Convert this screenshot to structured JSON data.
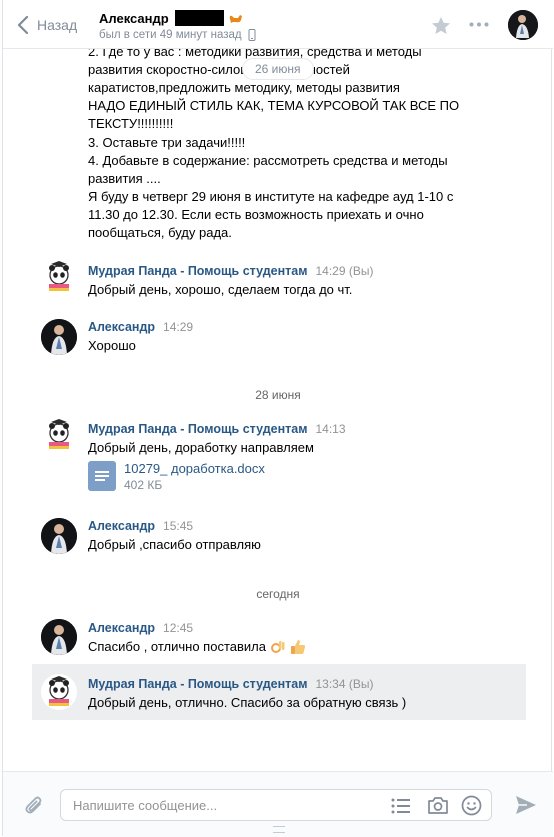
{
  "header": {
    "back_label": "Назад",
    "peer_name": "Александр",
    "status": "был в сети 49 минут назад"
  },
  "top_message_lines": [
    "2. Где то у вас : методики развития, средства и методы",
    "развития скоростно-силовых способностей",
    "каратистов,предложить методику, методы развития",
    "НАДО ЕДИНЫЙ СТИЛЬ КАК, ТЕМА КУРСОВОЙ ТАК ВСЕ ПО",
    "ТЕКСТУ!!!!!!!!!!",
    "3. Оставьте три задачи!!!!!",
    "4. Добавьте в содержание: рассмотреть средства и методы",
    "развития ....",
    "Я буду в четверг 29 июня в институте на кафедре ауд 1-10 с",
    "11.30 до 12.30. Если есть возможность приехать и очно",
    "пообщаться, буду рада."
  ],
  "floating_date": "26 июня",
  "messages": [
    {
      "author": "Мудрая Панда - Помощь студентам",
      "time": "14:29",
      "you": "(Вы)",
      "text": "Добрый день, хорошо, сделаем тогда до чт."
    },
    {
      "author": "Александр",
      "time": "14:29",
      "text": "Хорошо"
    },
    {
      "author": "Мудрая Панда - Помощь студентам",
      "time": "14:13",
      "text": "Добрый день, доработку направляем"
    },
    {
      "author": "Александр",
      "time": "15:45",
      "text": "Добрый ,спасибо отправляю"
    },
    {
      "author": "Александр",
      "time": "12:45",
      "text": "Спасибо , отлично поставила"
    },
    {
      "author": "Мудрая Панда - Помощь студентам",
      "time": "13:34",
      "you": "(Вы)",
      "text": "Добрый день, отлично. Спасибо за обратную связь )"
    }
  ],
  "date_separators": [
    "28 июня",
    "сегодня"
  ],
  "attachment": {
    "name": "10279_ доработка.docx",
    "size": "402 КБ"
  },
  "composer": {
    "placeholder": "Напишите сообщение..."
  },
  "colors": {
    "link": "#2a5885",
    "muted": "#818c99",
    "highlight": "#edeef0",
    "doc_icon": "#7c9ec7"
  },
  "icons": [
    "chevron-left-icon",
    "star-icon",
    "more-icon",
    "paperclip-icon",
    "list-icon",
    "camera-icon",
    "smile-icon",
    "send-icon",
    "phone-icon",
    "cat-icon"
  ]
}
